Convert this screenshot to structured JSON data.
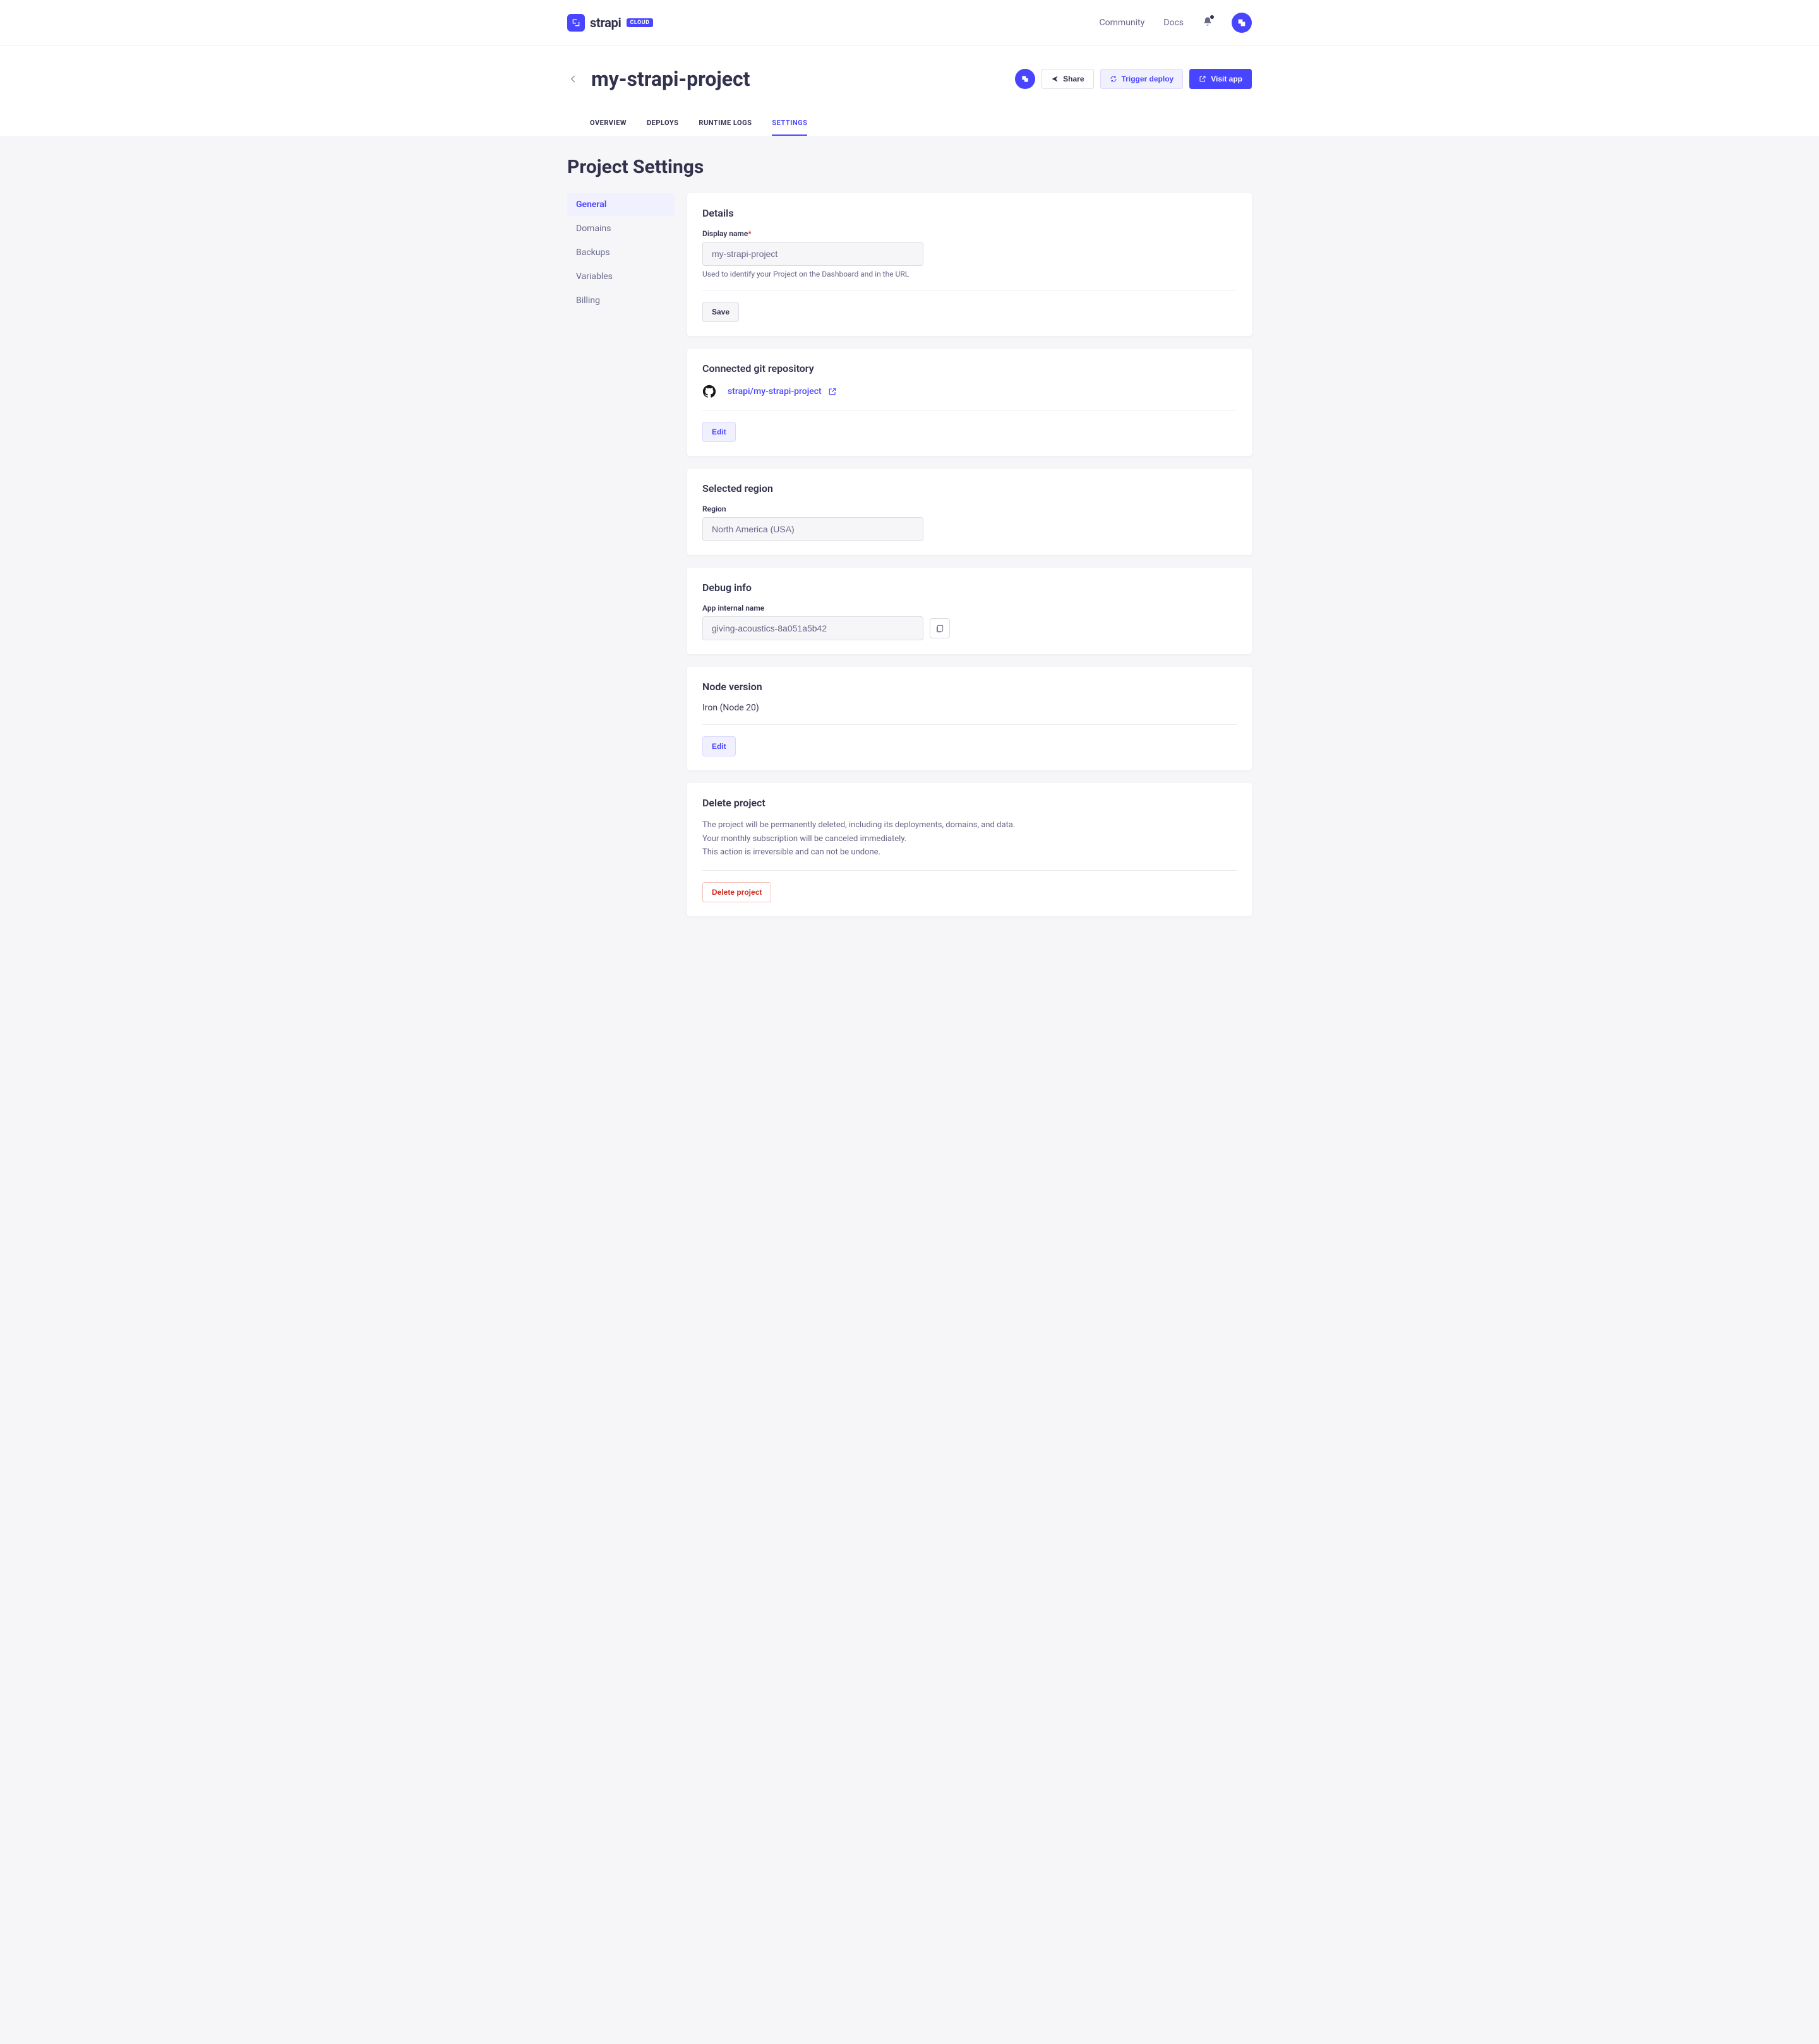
{
  "brand": {
    "name": "strapi",
    "badge": "CLOUD"
  },
  "topnav": {
    "community": "Community",
    "docs": "Docs"
  },
  "project": {
    "title": "my-strapi-project",
    "share": "Share",
    "trigger_deploy": "Trigger deploy",
    "visit_app": "Visit app"
  },
  "tabs": {
    "overview": "OVERVIEW",
    "deploys": "DEPLOYS",
    "runtime_logs": "RUNTIME LOGS",
    "settings": "SETTINGS"
  },
  "page": {
    "title": "Project Settings"
  },
  "sidebar": {
    "general": "General",
    "domains": "Domains",
    "backups": "Backups",
    "variables": "Variables",
    "billing": "Billing"
  },
  "details": {
    "title": "Details",
    "display_name_label": "Display name",
    "display_name_value": "my-strapi-project",
    "display_name_help": "Used to identify your Project on the Dashboard and in the URL",
    "save": "Save"
  },
  "repo": {
    "title": "Connected git repository",
    "name": "strapi/my-strapi-project",
    "edit": "Edit"
  },
  "region": {
    "title": "Selected region",
    "label": "Region",
    "value": "North America (USA)"
  },
  "debug": {
    "title": "Debug info",
    "label": "App internal name",
    "value": "giving-acoustics-8a051a5b42"
  },
  "node": {
    "title": "Node version",
    "value": "Iron (Node 20)",
    "edit": "Edit"
  },
  "delete": {
    "title": "Delete project",
    "line1": "The project will be permanently deleted, including its deployments, domains, and data.",
    "line2": "Your monthly subscription will be canceled immediately.",
    "line3": "This action is irreversible and can not be undone.",
    "button": "Delete project"
  }
}
